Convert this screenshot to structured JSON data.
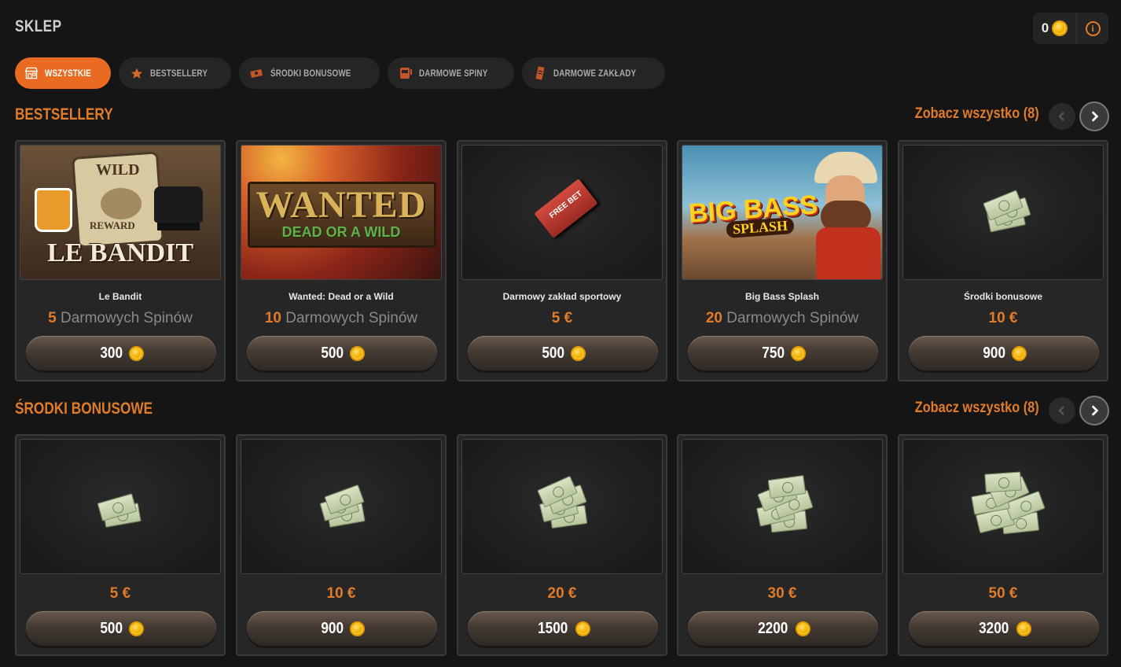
{
  "header": {
    "title": "SKLEP",
    "balance": "0",
    "info_icon": "info-icon"
  },
  "tabs": [
    {
      "label": "WSZYSTKIE",
      "icon": "shop-icon",
      "active": true
    },
    {
      "label": "BESTSELLERY",
      "icon": "star-icon",
      "active": false
    },
    {
      "label": "ŚRODKI BONUSOWE",
      "icon": "money-icon",
      "active": false
    },
    {
      "label": "DARMOWE SPINY",
      "icon": "slot-machine-icon",
      "active": false
    },
    {
      "label": "DARMOWE ZAKŁADY",
      "icon": "ticket-icon",
      "active": false
    }
  ],
  "colors": {
    "accent": "#e07b2a",
    "tab_active": "#e96a21",
    "background": "#151515",
    "card": "#262626"
  },
  "bestsellers": {
    "title": "BESTSELLERY",
    "see_all": "Zobacz wszystko (8)",
    "items": [
      {
        "name": "Le Bandit",
        "amount": "5",
        "unit": "Darmowych Spinów",
        "price": "300",
        "image": "le-bandit-art",
        "art_top": "WILD",
        "art_mid": "REWARD",
        "art_bottom": "LE BANDIT"
      },
      {
        "name": "Wanted: Dead or a Wild",
        "amount": "10",
        "unit": "Darmowych Spinów",
        "price": "500",
        "image": "wanted-art",
        "art_top": "WANTED",
        "art_bottom": "DEAD OR A WILD"
      },
      {
        "name": "Darmowy zakład sportowy",
        "amount": "5 €",
        "unit": "",
        "price": "500",
        "image": "free-bet-ticket",
        "art_top": "FREE BET"
      },
      {
        "name": "Big Bass Splash",
        "amount": "20",
        "unit": "Darmowych Spinów",
        "price": "750",
        "image": "big-bass-art",
        "art_top": "BIG BASS",
        "art_bottom": "SPLASH"
      },
      {
        "name": "Środki bonusowe",
        "amount": "10 €",
        "unit": "",
        "price": "900",
        "image": "cash-stack"
      }
    ]
  },
  "bonus_funds": {
    "title": "ŚRODKI BONUSOWE",
    "see_all": "Zobacz wszystko (8)",
    "items": [
      {
        "amount": "5 €",
        "price": "500",
        "image": "cash-stack"
      },
      {
        "amount": "10 €",
        "price": "900",
        "image": "cash-stack"
      },
      {
        "amount": "20 €",
        "price": "1500",
        "image": "cash-stack"
      },
      {
        "amount": "30 €",
        "price": "2200",
        "image": "cash-stack"
      },
      {
        "amount": "50 €",
        "price": "3200",
        "image": "cash-stack"
      }
    ]
  }
}
